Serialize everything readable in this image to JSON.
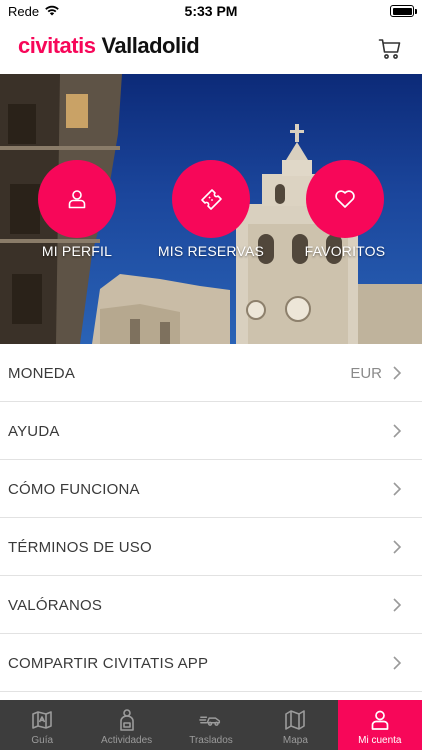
{
  "status_bar": {
    "carrier": "Rede",
    "time": "5:33 PM"
  },
  "header": {
    "brand": "civitatis",
    "city": "Valladolid",
    "cart_icon": "cart-icon"
  },
  "hero": {
    "buttons": [
      {
        "label": "MI PERFIL",
        "icon": "user-icon"
      },
      {
        "label": "MIS RESERVAS",
        "icon": "ticket-icon"
      },
      {
        "label": "FAVORITOS",
        "icon": "heart-icon"
      }
    ]
  },
  "menu": {
    "items": [
      {
        "label": "MONEDA",
        "value": "EUR"
      },
      {
        "label": "AYUDA",
        "value": ""
      },
      {
        "label": "CÓMO FUNCIONA",
        "value": ""
      },
      {
        "label": "TÉRMINOS DE USO",
        "value": ""
      },
      {
        "label": "VALÓRANOS",
        "value": ""
      },
      {
        "label": "COMPARTIR CIVITATIS APP",
        "value": ""
      }
    ]
  },
  "tabbar": {
    "tabs": [
      {
        "label": "Guía",
        "icon": "guide-icon"
      },
      {
        "label": "Actividades",
        "icon": "activities-icon"
      },
      {
        "label": "Traslados",
        "icon": "transfers-icon"
      },
      {
        "label": "Mapa",
        "icon": "map-icon"
      },
      {
        "label": "Mi cuenta",
        "icon": "account-icon",
        "active": true
      }
    ]
  },
  "colors": {
    "accent": "#f70759",
    "tabbar_bg": "#3d3d3d",
    "sky": "#1b469c"
  }
}
